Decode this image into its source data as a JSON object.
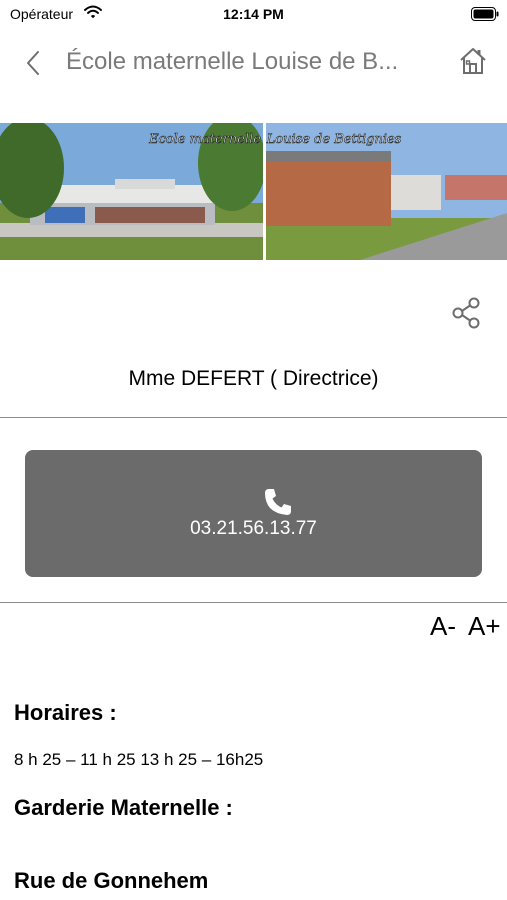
{
  "status_bar": {
    "carrier": "Opérateur",
    "time": "12:14 PM"
  },
  "header": {
    "title": "École maternelle Louise de B..."
  },
  "banner": {
    "left_caption": "Ecole maternelle",
    "right_caption": "Louise de Bettignies"
  },
  "contact": {
    "name": "Mme DEFERT ( Directrice)"
  },
  "call": {
    "phone": "03.21.56.13.77"
  },
  "font_controls": {
    "decrease": "A-",
    "increase": "A+"
  },
  "content": {
    "hours_heading": "Horaires :",
    "hours_text": "8 h 25 – 11 h 25 13 h 25 – 16h25",
    "daycare_heading": "Garderie Maternelle :",
    "street_heading": "Rue de Gonnehem"
  },
  "colors": {
    "call_button": "#6b6b6b",
    "title": "#7a7a7a",
    "accent_icon": "#6d6d6d"
  }
}
